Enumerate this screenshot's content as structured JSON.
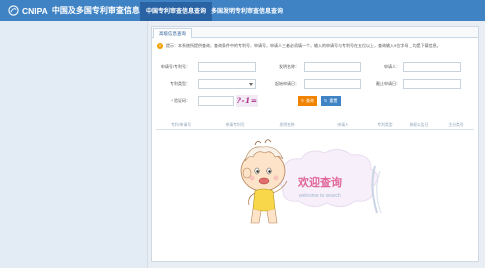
{
  "header": {
    "logo_text": "CNIPA",
    "logo_sub": "中国及多国专利审查信息查询",
    "tabs": [
      {
        "label": "中国专利审查信息查询",
        "active": true
      },
      {
        "label": "多国发明专利审查信息查询",
        "active": false
      }
    ]
  },
  "search_tab": {
    "label": "高级信息查询"
  },
  "tip": {
    "icon": "!",
    "text": "提示：本系统所提供查询，查询条件中的专利号、申请号，申请人三者必须填一个，输入的申请号与专利号在五位以上，查询输入9位字母 _ 均是下载信息。"
  },
  "form": {
    "application_no": {
      "label": "申请号/专利号：",
      "value": ""
    },
    "invention_name": {
      "label": "发明名称：",
      "value": ""
    },
    "applicant": {
      "label": "申请人：",
      "value": ""
    },
    "patent_type": {
      "label": "专利类型：",
      "value": ""
    },
    "start_date": {
      "label": "起始申请日：",
      "value": ""
    },
    "end_date": {
      "label": "截止申请日：",
      "value": ""
    },
    "captcha": {
      "label": "* 验证码：",
      "value": "",
      "image_text": "?-1="
    },
    "search_button": "查询",
    "clear_button": "重置"
  },
  "table": {
    "columns": [
      "专利/申请号",
      "申请专利号",
      "发明名称",
      "申请人",
      "专利类型",
      "授权公告日",
      "主分类号"
    ]
  },
  "welcome": {
    "title": "欢迎查询",
    "subtitle": "welcome to search"
  },
  "colors": {
    "primary": "#3f83c5",
    "nav_active": "#2a63a3",
    "search_button": "#f08300",
    "welcome_text": "#e0669b"
  }
}
